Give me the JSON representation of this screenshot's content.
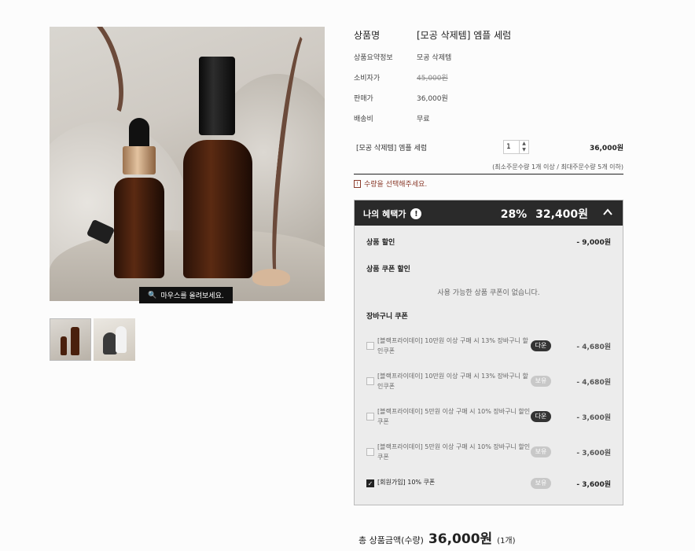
{
  "zoom_hint": "마우스를 올려보세요.",
  "product": {
    "rows": [
      {
        "key": "상품명",
        "value": "[모공 삭제템] 엠플 세럼"
      },
      {
        "key": "상품요약정보",
        "value": "모공 삭제템"
      },
      {
        "key": "소비자가",
        "value": "45,000원"
      },
      {
        "key": "판매가",
        "value": "36,000원"
      },
      {
        "key": "배송비",
        "value": "무료"
      }
    ]
  },
  "option": {
    "name": "[모공 삭제템] 엠플 세럼",
    "quantity": "1",
    "price": "36,000원",
    "limit_text": "(최소주문수량 1개 이상 / 최대주문수량 5개 이하)",
    "notice": "수량을 선택해주세요."
  },
  "benefit": {
    "title": "나의 혜택가",
    "percent": "28%",
    "amount": "32,400원",
    "product_discount_label": "상품 할인",
    "product_discount_value": "- 9,000원",
    "product_coupon_label": "상품 쿠폰 할인",
    "no_coupon_text": "사용 가능한 상품 쿠폰이 없습니다.",
    "cart_coupon_label": "장바구니 쿠폰",
    "coupons": [
      {
        "text": "[블랙프라이데이] 10만원 이상 구매 시 13% 장바구니 할인쿠폰",
        "badge": "다운",
        "badge_style": "dark",
        "price": "- 4,680원",
        "checked": false
      },
      {
        "text": "[블랙프라이데이] 10만원 이상 구매 시 13% 장바구니 할인쿠폰",
        "badge": "보유",
        "badge_style": "light",
        "price": "- 4,680원",
        "checked": false
      },
      {
        "text": "[블랙프라이데이] 5만원 이상 구매 시 10% 장바구니 할인쿠폰",
        "badge": "다운",
        "badge_style": "dark",
        "price": "- 3,600원",
        "checked": false
      },
      {
        "text": "[블랙프라이데이] 5만원 이상 구매 시 10% 장바구니 할인쿠폰",
        "badge": "보유",
        "badge_style": "light",
        "price": "- 3,600원",
        "checked": false
      },
      {
        "text": "[회원가입] 10% 쿠폰",
        "badge": "보유",
        "badge_style": "light",
        "price": "- 3,600원",
        "checked": true
      }
    ]
  },
  "total": {
    "label": "총 상품금액(수량)",
    "price": "36,000원",
    "count": "(1개)"
  }
}
